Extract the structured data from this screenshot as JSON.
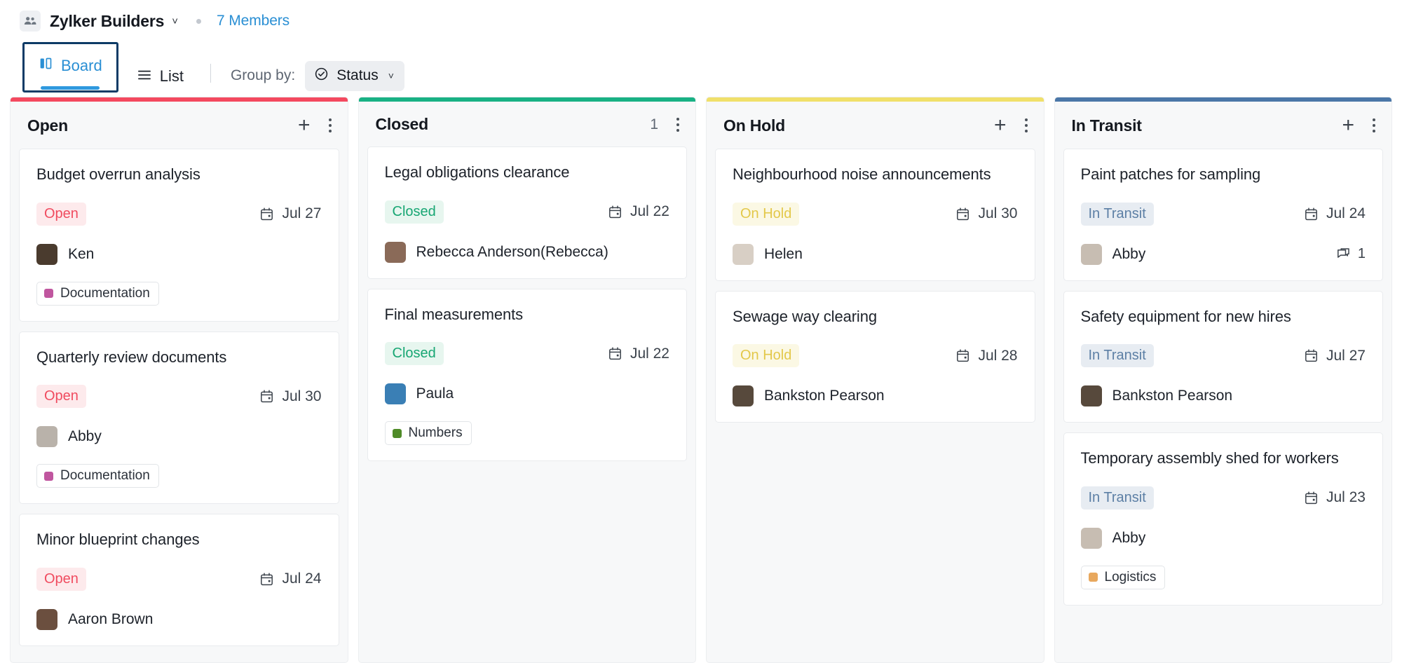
{
  "header": {
    "team_icon": "people-icon",
    "team_name": "Zylker Builders",
    "chevron": "˅",
    "members_label": "7 Members"
  },
  "toolbar": {
    "tabs": [
      {
        "label": "Board",
        "icon": "board-icon",
        "active": true
      },
      {
        "label": "List",
        "icon": "list-icon",
        "active": false
      }
    ],
    "groupby_label": "Group by:",
    "groupby_value": "Status",
    "groupby_icon": "check-circle-icon",
    "groupby_chevron": "˅"
  },
  "colors": {
    "open": "#f4495f",
    "closed": "#18b184",
    "onhold": "#f0e06a",
    "intransit": "#4b77a8",
    "accent": "#2a8fd4",
    "focus_ring": "#0d3b66"
  },
  "columns": [
    {
      "id": "open",
      "title": "Open",
      "bar_color": "#f4495f",
      "count": "",
      "add_label": "+",
      "cards": [
        {
          "title": "Budget overrun analysis",
          "status": "Open",
          "status_class": "chip-open",
          "date": "Jul 27",
          "assignee": "Ken",
          "avatar_color": "#4a3b2e",
          "comments": "",
          "tags": [
            {
              "label": "Documentation",
              "color": "#c0569f"
            }
          ]
        },
        {
          "title": "Quarterly review documents",
          "status": "Open",
          "status_class": "chip-open",
          "date": "Jul 30",
          "assignee": "Abby",
          "avatar_color": "#b9b2aa",
          "comments": "",
          "tags": [
            {
              "label": "Documentation",
              "color": "#c0569f"
            }
          ]
        },
        {
          "title": "Minor blueprint changes",
          "status": "Open",
          "status_class": "chip-open",
          "date": "Jul 24",
          "assignee": "Aaron Brown",
          "avatar_color": "#6b4f3f",
          "comments": "",
          "tags": []
        }
      ]
    },
    {
      "id": "closed",
      "title": "Closed",
      "bar_color": "#18b184",
      "count": "1",
      "add_label": "",
      "cards": [
        {
          "title": "Legal obligations clearance",
          "status": "Closed",
          "status_class": "chip-closed",
          "date": "Jul 22",
          "assignee": "Rebecca Anderson(Rebecca)",
          "avatar_color": "#8a6a58",
          "comments": "",
          "tags": []
        },
        {
          "title": "Final measurements",
          "status": "Closed",
          "status_class": "chip-closed",
          "date": "Jul 22",
          "assignee": "Paula",
          "avatar_color": "#3a7fb5",
          "comments": "",
          "tags": [
            {
              "label": "Numbers",
              "color": "#4f8b28"
            }
          ]
        }
      ]
    },
    {
      "id": "onhold",
      "title": "On Hold",
      "bar_color": "#f0e06a",
      "count": "",
      "add_label": "+",
      "cards": [
        {
          "title": "Neighbourhood noise announcements",
          "status": "On Hold",
          "status_class": "chip-onhold",
          "date": "Jul 30",
          "assignee": "Helen",
          "avatar_color": "#d8cfc5",
          "comments": "",
          "tags": []
        },
        {
          "title": "Sewage way clearing",
          "status": "On Hold",
          "status_class": "chip-onhold",
          "date": "Jul 28",
          "assignee": "Bankston Pearson",
          "avatar_color": "#57493c",
          "comments": "",
          "tags": []
        }
      ]
    },
    {
      "id": "intransit",
      "title": "In Transit",
      "bar_color": "#4b77a8",
      "count": "",
      "add_label": "+",
      "cards": [
        {
          "title": "Paint patches for sampling",
          "status": "In Transit",
          "status_class": "chip-transit",
          "date": "Jul 24",
          "assignee": "Abby",
          "avatar_color": "#c7bdb2",
          "comments": "1",
          "tags": []
        },
        {
          "title": "Safety equipment for new hires",
          "status": "In Transit",
          "status_class": "chip-transit",
          "date": "Jul 27",
          "assignee": "Bankston Pearson",
          "avatar_color": "#57493c",
          "comments": "",
          "tags": []
        },
        {
          "title": "Temporary assembly shed for workers",
          "status": "In Transit",
          "status_class": "chip-transit",
          "date": "Jul 23",
          "assignee": "Abby",
          "avatar_color": "#c7bdb2",
          "comments": "",
          "tags": [
            {
              "label": "Logistics",
              "color": "#e8a85e"
            }
          ]
        }
      ]
    }
  ]
}
